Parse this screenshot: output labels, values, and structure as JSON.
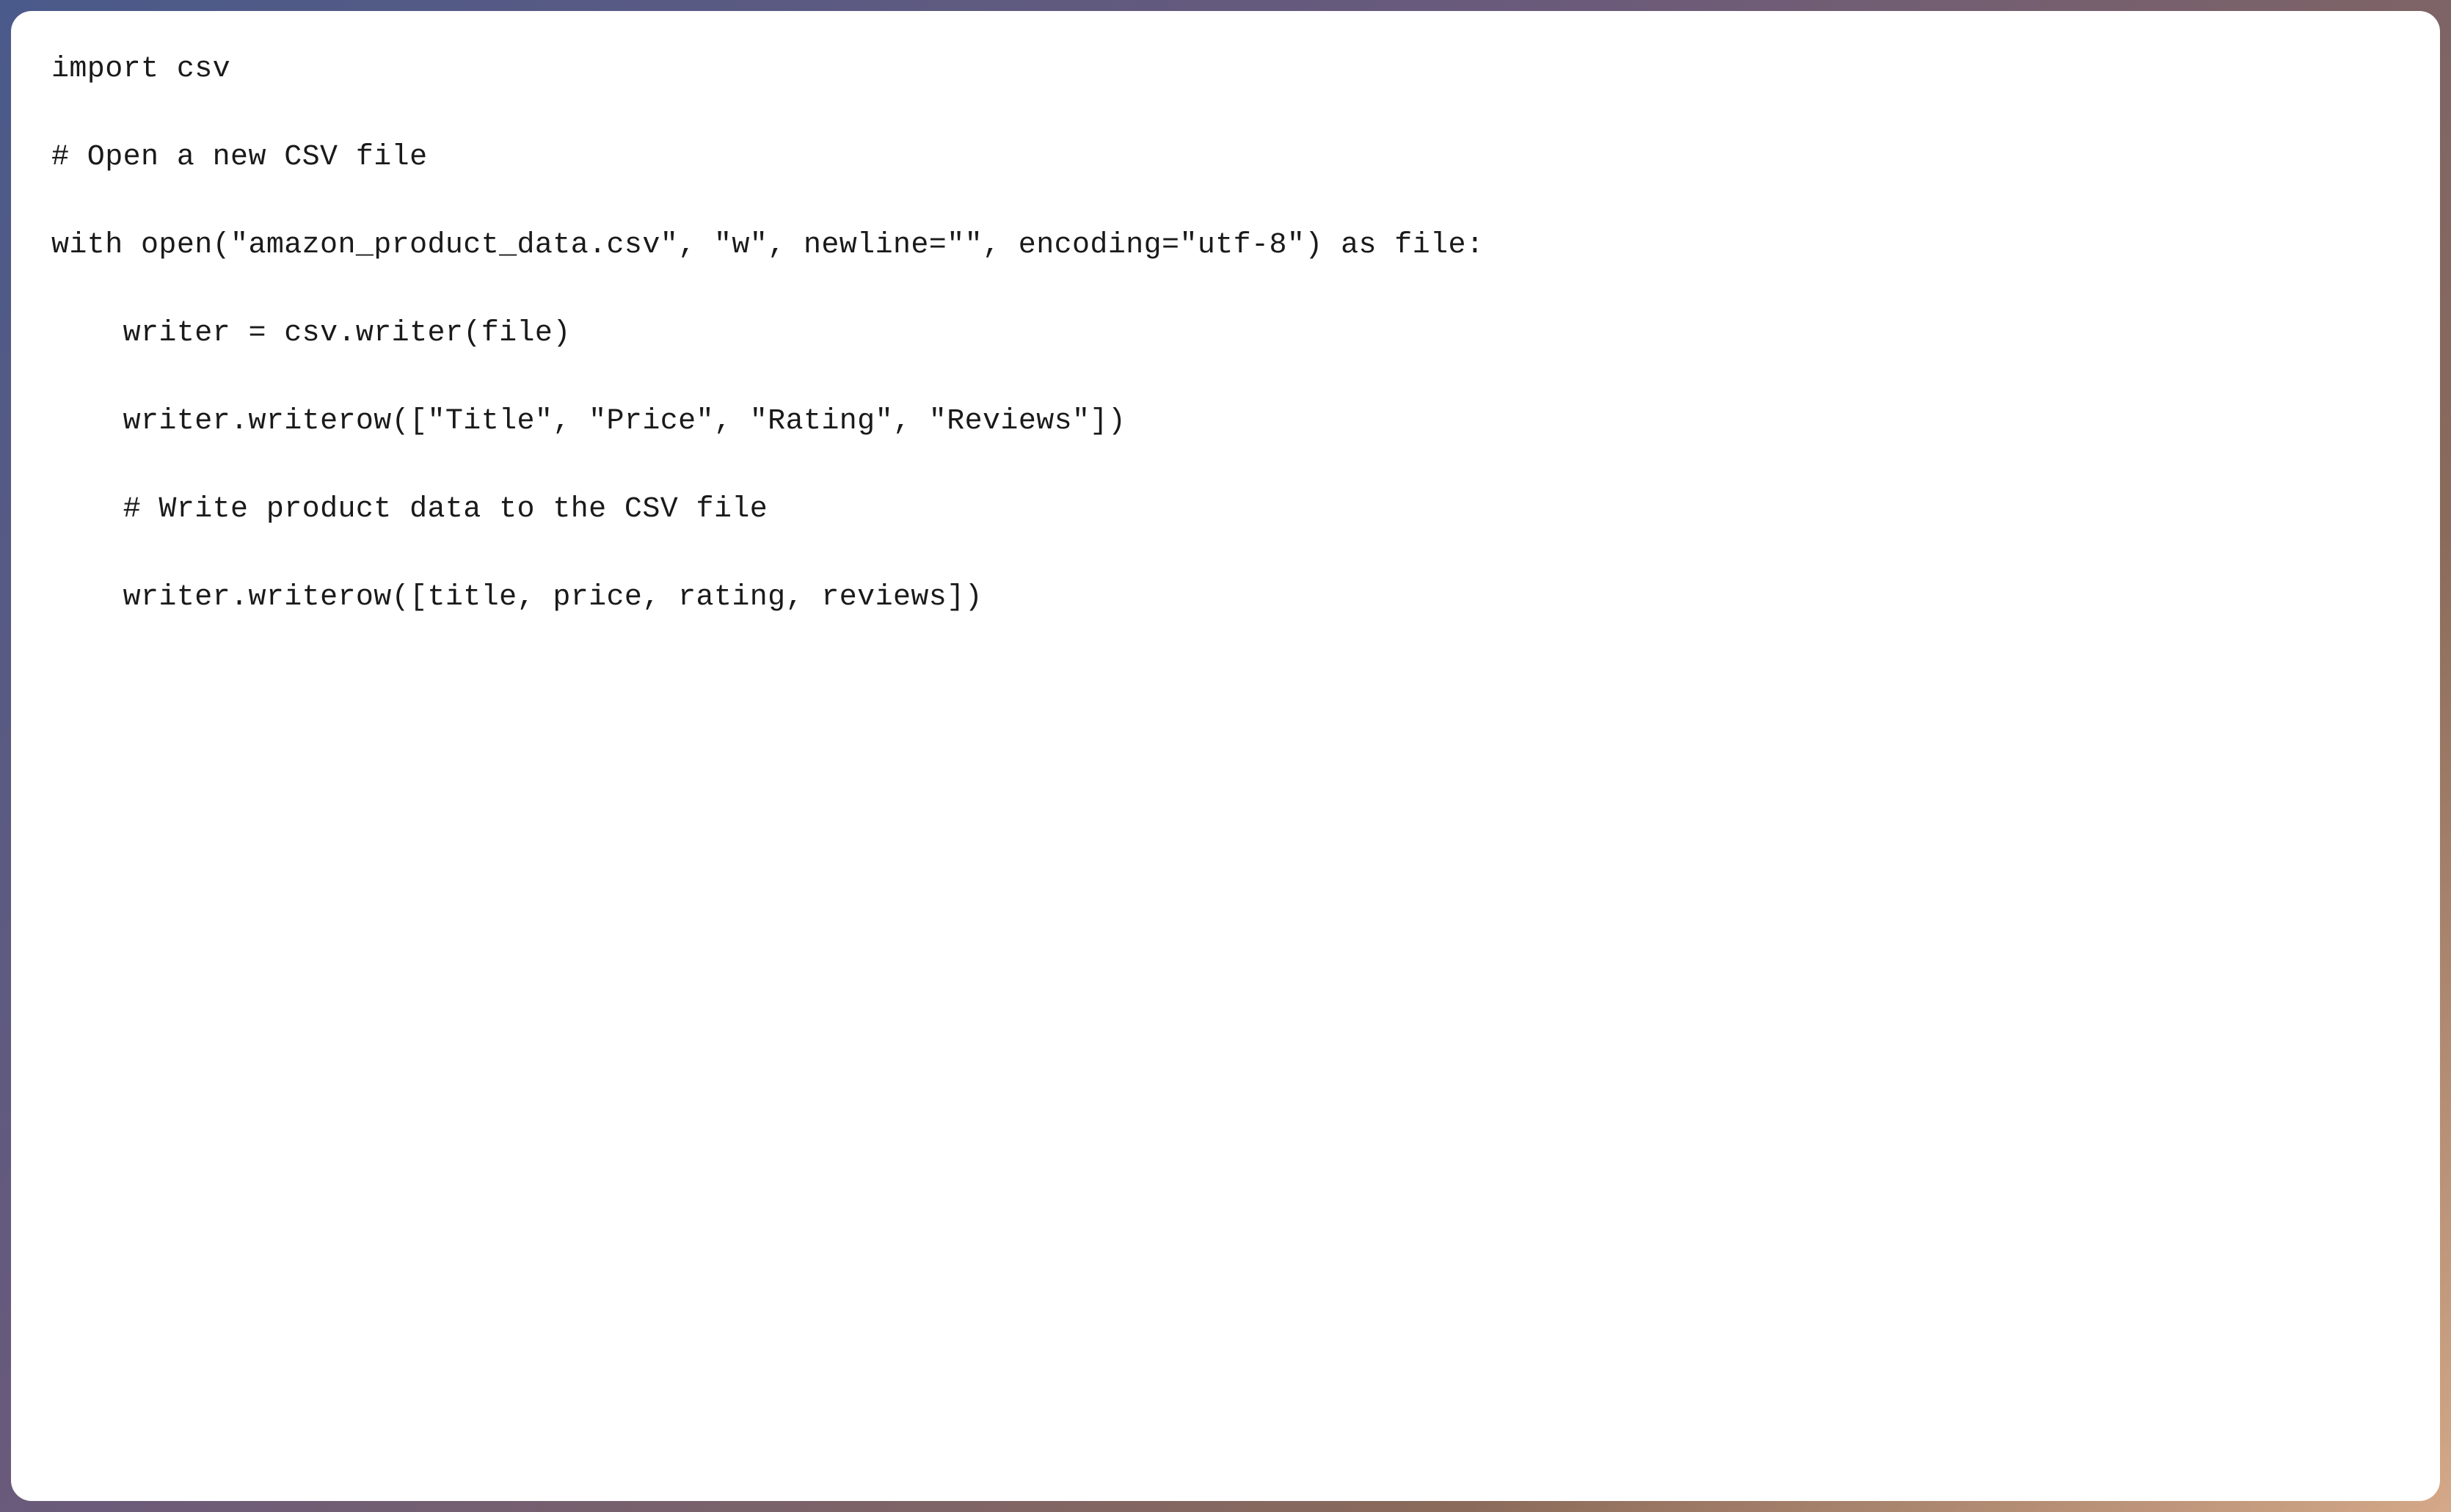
{
  "code": {
    "line1": "import csv",
    "blank1": "",
    "line2": "# Open a new CSV file",
    "blank2": "",
    "line3": "with open(\"amazon_product_data.csv\", \"w\", newline=\"\", encoding=\"utf-8\") as file:",
    "blank3": "",
    "line4": "    writer = csv.writer(file)",
    "blank4": "",
    "line5": "    writer.writerow([\"Title\", \"Price\", \"Rating\", \"Reviews\"])",
    "blank5": "",
    "line6": "    # Write product data to the CSV file",
    "blank6": "",
    "line7": "    writer.writerow([title, price, rating, reviews])"
  }
}
